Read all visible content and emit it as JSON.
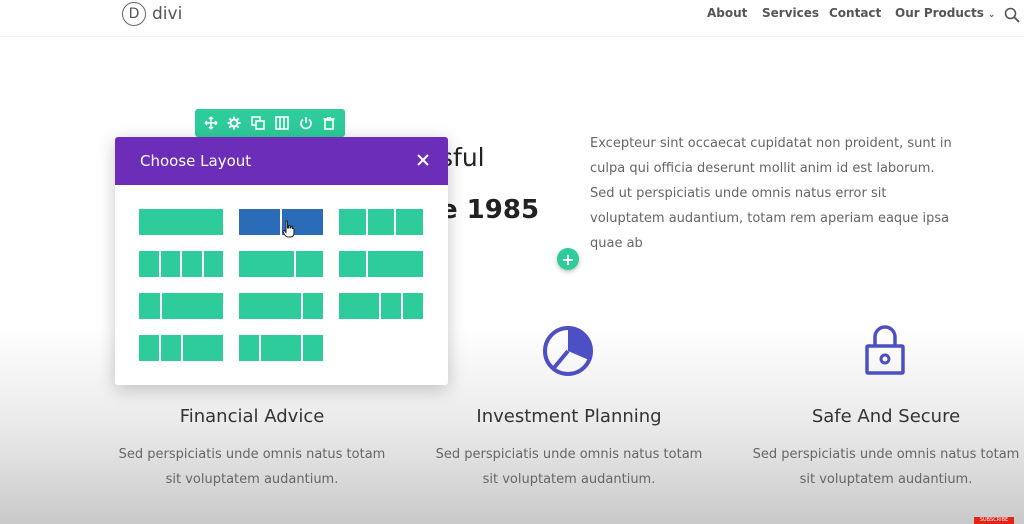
{
  "header": {
    "logo_mark": "D",
    "logo_text": "divi",
    "nav": [
      "About",
      "Services",
      "Contact",
      "Our Products"
    ],
    "products_chevron": "⌄"
  },
  "hero": {
    "title_line1_partial": "sful",
    "title_line2_partial": "e 1985",
    "text": "Excepteur sint occaecat cupidatat non proident, sunt in culpa qui officia deserunt mollit anim id est laborum. Sed ut perspiciatis unde omnis natus error sit voluptatem audantium, totam rem aperiam eaque ipsa quae ab"
  },
  "toolbar": {
    "icons": [
      "move-icon",
      "gear-icon",
      "duplicate-icon",
      "columns-icon",
      "power-icon",
      "trash-icon"
    ]
  },
  "modal": {
    "title": "Choose Layout",
    "close": "×",
    "selected_option": "1/2 + 1/2",
    "options": [
      {
        "name": "1 column",
        "cols": [
          1
        ]
      },
      {
        "name": "1/2 + 1/2",
        "cols": [
          1,
          1
        ]
      },
      {
        "name": "1/3 + 1/3 + 1/3",
        "cols": [
          1,
          1,
          1
        ]
      },
      {
        "name": "1/4 + 1/4 + 1/4 + 1/4",
        "cols": [
          1,
          1,
          1,
          1
        ]
      },
      {
        "name": "2/3 + 1/3",
        "cols": [
          2,
          1
        ]
      },
      {
        "name": "1/3 + 2/3",
        "cols": [
          1,
          2
        ]
      },
      {
        "name": "1/4 + 3/4",
        "cols": [
          1,
          3
        ]
      },
      {
        "name": "3/4 + 1/4",
        "cols": [
          3,
          1
        ]
      },
      {
        "name": "1/4 + 1/4 + 1/2",
        "cols": [
          1,
          1,
          2
        ]
      },
      {
        "name": "1/4 + 1/4 + 1/2 (alt)",
        "cols": [
          1,
          1,
          2
        ]
      },
      {
        "name": "1/4 + 1/2 + 1/4",
        "cols": [
          1,
          2,
          1
        ]
      }
    ]
  },
  "add_button": "+",
  "features": [
    {
      "icon": "pie-chart-icon",
      "title": "Financial Advice",
      "text": "Sed perspiciatis unde omnis natus totam sit voluptatem audantium."
    },
    {
      "icon": "pie-chart-icon",
      "title": "Investment Planning",
      "text": "Sed perspiciatis unde omnis natus totam sit voluptatem audantium."
    },
    {
      "icon": "lock-icon",
      "title": "Safe And Secure",
      "text": "Sed perspiciatis unde omnis natus totam sit voluptatem audantium."
    }
  ],
  "badge": "SUBSCRIBE",
  "colors": {
    "accent_green": "#2ecc9a",
    "modal_purple": "#6c2eb9",
    "selected_blue": "#2b6cb8",
    "icon_indigo": "#4d4fc4"
  }
}
